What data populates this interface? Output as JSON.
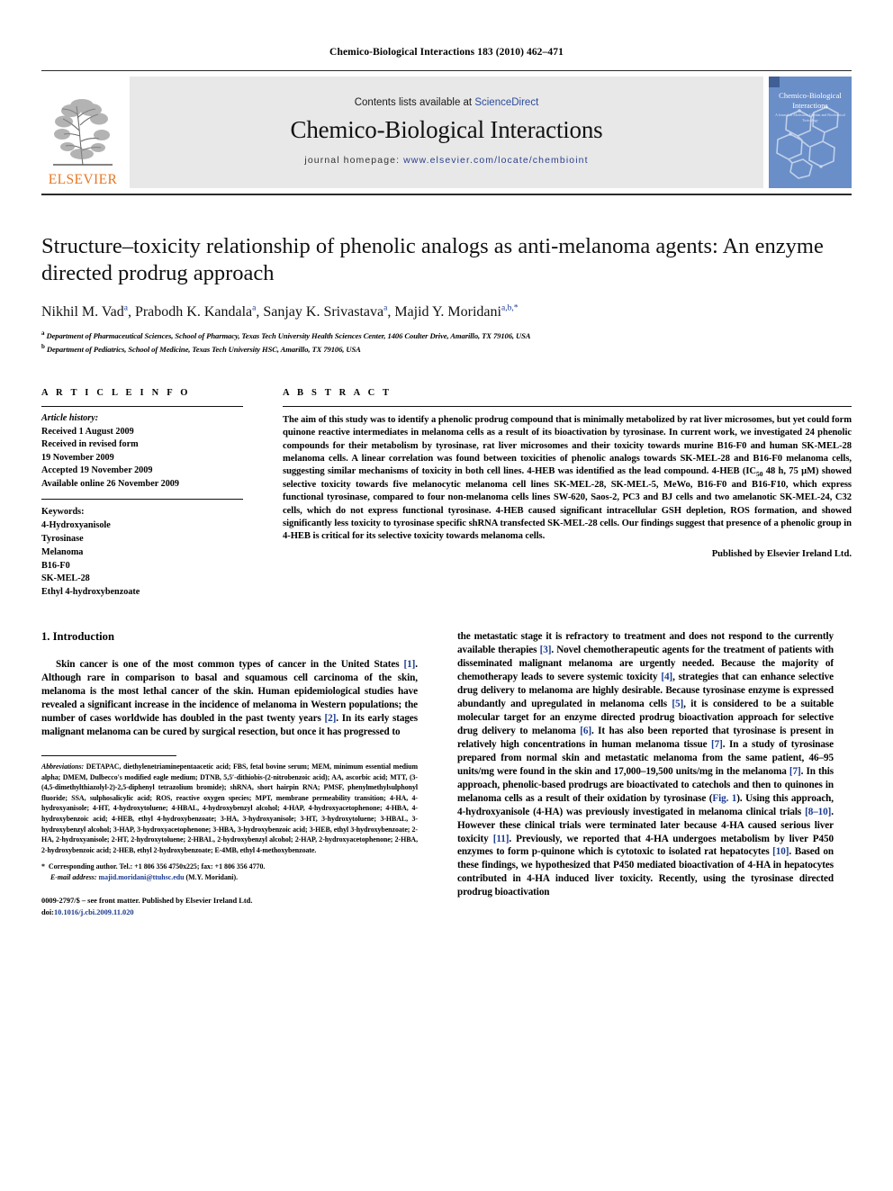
{
  "running_head": "Chemico-Biological Interactions 183 (2010) 462–471",
  "masthead": {
    "publisher_name": "ELSEVIER",
    "contents_prefix": "Contents lists available at ",
    "contents_link": "ScienceDirect",
    "journal_name": "Chemico-Biological Interactions",
    "homepage_prefix": "journal homepage: ",
    "homepage_url": "www.elsevier.com/locate/chembioint",
    "cover": {
      "line1": "Chemico-Biological",
      "line2": "Interactions",
      "subtitle": "A Journal of Molecular, Cellular and Biochemical Toxicology"
    },
    "cover_color": "#6a8ec8",
    "link_color": "#2b4c9b",
    "elsevier_orange": "#e87722"
  },
  "article": {
    "title": "Structure–toxicity relationship of phenolic analogs as anti-melanoma agents: An enzyme directed prodrug approach",
    "authors": "Nikhil M. Vad , Prabodh K. Kandala , Sanjay K. Srivastava , Majid Y. Moridani",
    "affiliation_a": "Department of Pharmaceutical Sciences, School of Pharmacy, Texas Tech University Health Sciences Center, 1406 Coulter Drive, Amarillo, TX 79106, USA",
    "affiliation_b": "Department of Pediatrics, School of Medicine, Texas Tech University HSC, Amarillo, TX 79106, USA"
  },
  "info": {
    "heading": "A R T I C L E    I N F O",
    "history_label": "Article history:",
    "history": [
      "Received 1 August 2009",
      "Received in revised form",
      "19 November 2009",
      "Accepted 19 November 2009",
      "Available online 26 November 2009"
    ],
    "keywords_label": "Keywords:",
    "keywords": [
      "4-Hydroxyanisole",
      "Tyrosinase",
      "Melanoma",
      "B16-F0",
      "SK-MEL-28",
      "Ethyl 4-hydroxybenzoate"
    ]
  },
  "abstract": {
    "heading": "A B S T R A C T",
    "text_part1": "The aim of this study was to identify a phenolic prodrug compound that is minimally metabolized by rat liver microsomes, but yet could form quinone reactive intermediates in melanoma cells as a result of its bioactivation by tyrosinase. In current work, we investigated 24 phenolic compounds for their metabolism by tyrosinase, rat liver microsomes and their toxicity towards murine B16-F0 and human SK-MEL-28 melanoma cells. A linear correlation was found between toxicities of phenolic analogs towards SK-MEL-28 and B16-F0 melanoma cells, suggesting similar mechanisms of toxicity in both cell lines. 4-HEB was identified as the lead compound. 4-HEB (IC",
    "sub": "50",
    "text_part2": " 48 h, 75 μM) showed selective toxicity towards five melanocytic melanoma cell lines SK-MEL-28, SK-MEL-5, MeWo, B16-F0 and B16-F10, which express functional tyrosinase, compared to four non-melanoma cells lines SW-620, Saos-2, PC3 and BJ cells and two amelanotic SK-MEL-24, C32 cells, which do not express functional tyrosinase. 4-HEB caused significant intracellular GSH depletion, ROS formation, and showed significantly less toxicity to tyrosinase specific shRNA transfected SK-MEL-28 cells. Our findings suggest that presence of a phenolic group in 4-HEB is critical for its selective toxicity towards melanoma cells.",
    "published_by": "Published by Elsevier Ireland Ltd."
  },
  "introduction": {
    "heading": "1.  Introduction",
    "left_p1_a": "Skin cancer is one of the most common types of cancer in the United States ",
    "left_ref1": "[1]",
    "left_p1_b": ". Although rare in comparison to basal and squamous cell carcinoma of the skin, melanoma is the most lethal cancer of the skin. Human epidemiological studies have revealed a significant increase in the incidence of melanoma in Western populations; the number of cases worldwide has doubled in the past twenty years ",
    "left_ref2": "[2]",
    "left_p1_c": ". In its early stages malignant melanoma can be cured by surgical resection, but once it has progressed to",
    "right_a": "the metastatic stage it is refractory to treatment and does not respond to the currently available therapies ",
    "right_ref3": "[3]",
    "right_b": ". Novel chemotherapeutic agents for the treatment of patients with disseminated malignant melanoma are urgently needed. Because the majority of chemotherapy leads to severe systemic toxicity ",
    "right_ref4": "[4]",
    "right_c": ", strategies that can enhance selective drug delivery to melanoma are highly desirable. Because tyrosinase enzyme is expressed abundantly and upregulated in melanoma cells ",
    "right_ref5": "[5]",
    "right_d": ", it is considered to be a suitable molecular target for an enzyme directed prodrug bioactivation approach for selective drug delivery to melanoma ",
    "right_ref6": "[6]",
    "right_e": ". It has also been reported that tyrosinase is present in relatively high concentrations in human melanoma tissue ",
    "right_ref7": "[7]",
    "right_f": ". In a study of tyrosinase prepared from normal skin and metastatic melanoma from the same patient, 46–95 units/mg were found in the skin and 17,000–19,500 units/mg in the melanoma ",
    "right_ref7b": "[7]",
    "right_g": ". In this approach, phenolic-based prodrugs are bioactivated to catechols and then to quinones in melanoma cells as a result of their oxidation by tyrosinase (",
    "right_fig1": "Fig. 1",
    "right_h": "). Using this approach, 4-hydroxyanisole (4-HA) was previously investigated in melanoma clinical trials ",
    "right_ref810": "[8–10]",
    "right_i": ". However these clinical trials were terminated later because 4-HA caused serious liver toxicity ",
    "right_ref11": "[11]",
    "right_j": ". Previously, we reported that 4-HA undergoes metabolism by liver P450 enzymes to form p-quinone which is cytotoxic to isolated rat hepatocytes ",
    "right_ref10": "[10]",
    "right_k": ". Based on these findings, we hypothesized that P450 mediated bioactivation of 4-HA in hepatocytes contributed in 4-HA induced liver toxicity. Recently, using the tyrosinase directed prodrug bioactivation"
  },
  "footnotes": {
    "abbrev_label": "Abbreviations:",
    "abbrev_text": " DETAPAC, diethylenetriaminepentaacetic acid; FBS, fetal bovine serum; MEM, minimum essential medium alpha; DMEM, Dulbecco's modified eagle medium; DTNB, 5,5′-dithiobis-(2-nitrobenzoic acid); AA, ascorbic acid; MTT, (3-(4,5-dimethylthiazolyl-2)-2,5-diphenyl tetrazolium bromide); shRNA, short hairpin RNA; PMSF, phenylmethylsulphonyl fluoride; SSA, sulphosalicylic acid; ROS, reactive oxygen species; MPT, membrane permeability transition; 4-HA, 4-hydroxyanisole; 4-HT, 4-hydroxytoluene; 4-HBAL, 4-hydroxybenzyl alcohol; 4-HAP, 4-hydroxyacetophenone; 4-HBA, 4-hydroxybenzoic acid; 4-HEB, ethyl 4-hydroxybenzoate; 3-HA, 3-hydroxyanisole; 3-HT, 3-hydroxytoluene; 3-HBAL, 3-hydroxybenzyl alcohol; 3-HAP, 3-hydroxyacetophenone; 3-HBA, 3-hydroxybenzoic acid; 3-HEB, ethyl 3-hydroxybenzoate; 2-HA, 2-hydroxyanisole; 2-HT, 2-hydroxytoluene; 2-HBAL, 2-hydroxybenzyl alcohol; 2-HAP, 2-hydroxyacetophenone; 2-HBA, 2-hydroxybenzoic acid; 2-HEB, ethyl 2-hydroxybenzoate; E-4MB, ethyl 4-methoxybenzoate.",
    "corr_marker": "*",
    "corr_text": "Corresponding author. Tel.: +1 806 356 4750x225; fax: +1 806 356 4770.",
    "email_label": "E-mail address:",
    "email": "majid.moridani@ttuhsc.edu",
    "email_suffix": " (M.Y. Moridani).",
    "imprint": "0009-2797/$ – see front matter. Published by Elsevier Ireland Ltd.",
    "doi_label": "doi:",
    "doi": "10.1016/j.cbi.2009.11.020"
  }
}
